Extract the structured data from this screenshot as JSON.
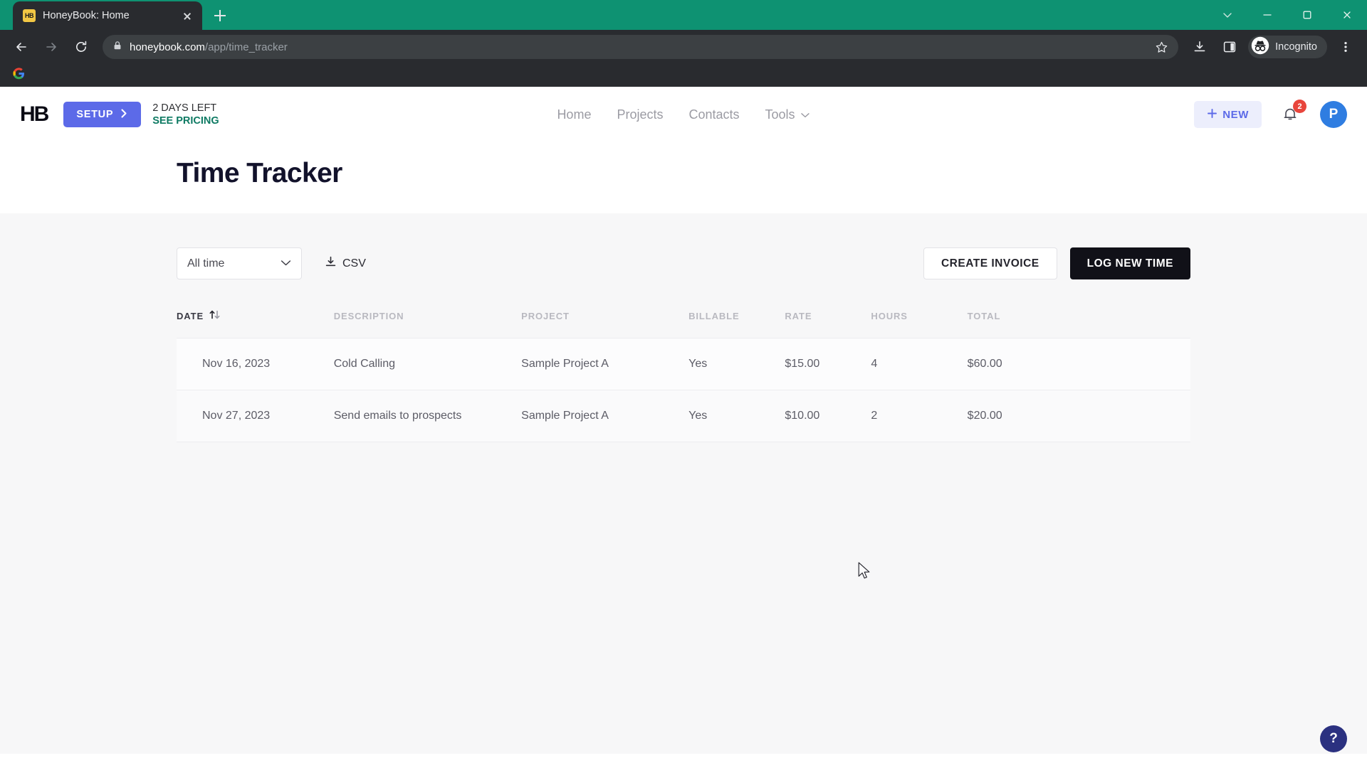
{
  "browser": {
    "tab": {
      "title": "HoneyBook: Home",
      "favicon_label": "HB",
      "favicon_name": "honeybook-favicon"
    },
    "new_tab_label": "New tab",
    "window_controls": [
      "chevron-down-icon",
      "minimize-icon",
      "maximize-icon",
      "close-icon"
    ],
    "nav": {
      "back": "Back",
      "forward": "Forward",
      "reload": "Reload"
    },
    "address": {
      "lock_icon": "lock-icon",
      "domain": "honeybook.com",
      "path": "/app/time_tracker",
      "full_url": "honeybook.com/app/time_tracker"
    },
    "toolbar_icons": [
      "bookmark-star-icon",
      "download-icon",
      "side-panel-icon",
      "more-menu-icon"
    ],
    "profile": {
      "label": "Incognito",
      "icon": "incognito-icon"
    },
    "bookmarks": [
      {
        "label": "",
        "icon": "google-icon"
      }
    ]
  },
  "app": {
    "logo": "HB",
    "setup_button": "SETUP",
    "trial_days": "2 DAYS LEFT",
    "pricing_link": "SEE PRICING",
    "nav": [
      {
        "label": "Home",
        "has_caret": false
      },
      {
        "label": "Projects",
        "has_caret": false
      },
      {
        "label": "Contacts",
        "has_caret": false
      },
      {
        "label": "Tools",
        "has_caret": true
      }
    ],
    "new_button": "NEW",
    "notifications_count": "2",
    "avatar_initial": "P",
    "page_title": "Time Tracker",
    "help_button": "?"
  },
  "toolbar": {
    "date_filter_value": "All time",
    "date_filter_options": [
      "All time"
    ],
    "csv_label": "CSV",
    "create_invoice_label": "CREATE INVOICE",
    "log_new_time_label": "LOG NEW TIME"
  },
  "table": {
    "columns": [
      {
        "key": "date",
        "label": "DATE",
        "sorted": true
      },
      {
        "key": "description",
        "label": "DESCRIPTION",
        "sorted": false
      },
      {
        "key": "project",
        "label": "PROJECT",
        "sorted": false
      },
      {
        "key": "billable",
        "label": "BILLABLE",
        "sorted": false
      },
      {
        "key": "rate",
        "label": "RATE",
        "sorted": false
      },
      {
        "key": "hours",
        "label": "HOURS",
        "sorted": false
      },
      {
        "key": "total",
        "label": "TOTAL",
        "sorted": false
      }
    ],
    "rows": [
      {
        "date": "Nov 16, 2023",
        "description": "Cold Calling",
        "project": "Sample Project A",
        "billable": "Yes",
        "rate": "$15.00",
        "hours": "4",
        "total": "$60.00"
      },
      {
        "date": "Nov 27, 2023",
        "description": "Send emails to prospects",
        "project": "Sample Project A",
        "billable": "Yes",
        "rate": "$10.00",
        "hours": "2",
        "total": "$20.00"
      }
    ]
  },
  "colors": {
    "browser_accent": "#0e9272",
    "browser_chrome": "#292b2f",
    "setup_blue": "#5c6ae8",
    "pricing_green": "#0e7a63",
    "badge_red": "#e8453c",
    "avatar_blue": "#2f7de1",
    "dark_button": "#111118",
    "help_navy": "#2b3180"
  }
}
